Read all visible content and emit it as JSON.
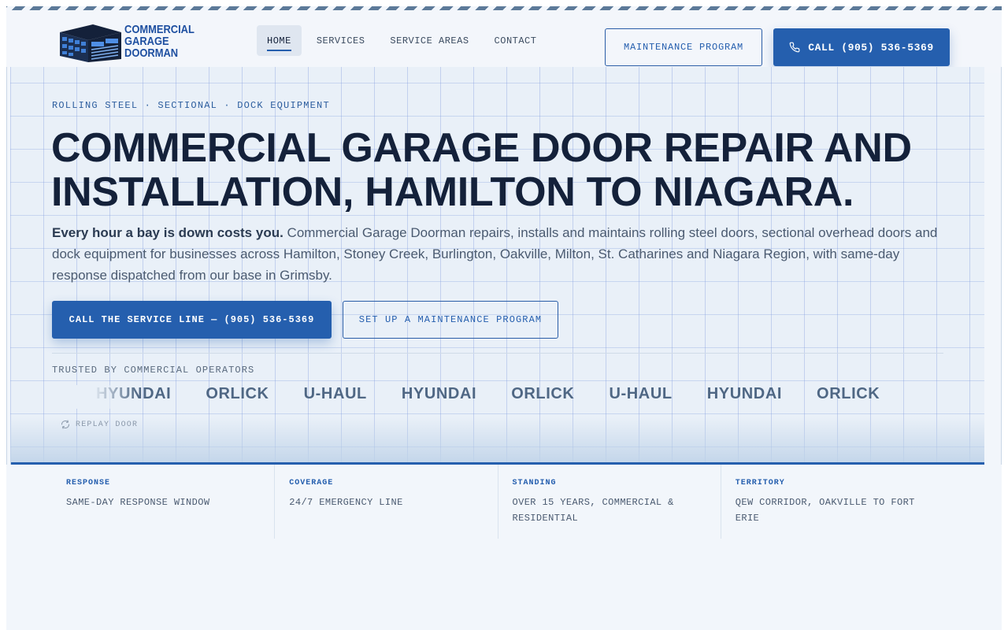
{
  "brand": {
    "logo_lines": [
      "COMMERCIAL",
      "GARAGE",
      "DOORMAN"
    ],
    "accent": "#255fae",
    "ink": "#14213a"
  },
  "nav": {
    "items": [
      {
        "label": "HOME",
        "active": true
      },
      {
        "label": "SERVICES",
        "active": false
      },
      {
        "label": "SERVICE AREAS",
        "active": false
      },
      {
        "label": "CONTACT",
        "active": false
      }
    ],
    "maintenance_button": "MAINTENANCE PROGRAM",
    "call_button": "CALL (905) 536-5369",
    "call_icon": "phone-icon"
  },
  "hero": {
    "eyebrow": "ROLLING STEEL · SECTIONAL · DOCK EQUIPMENT",
    "headline": "COMMERCIAL GARAGE DOOR REPAIR AND INSTALLATION, HAMILTON TO NIAGARA.",
    "lede_strong": "Every hour a bay is down costs you.",
    "lede_text": " Commercial Garage Doorman repairs, installs and maintains rolling steel doors, sectional overhead doors and dock equipment for businesses across Hamilton, Stoney Creek, Burlington, Oakville, Milton, St. Catharines and Niagara Region, with same-day response dispatched from our base in Grimsby.",
    "primary_cta": "CALL THE SERVICE LINE — (905) 536-5369",
    "secondary_cta": "SET UP A MAINTENANCE PROGRAM",
    "trusted_label": "TRUSTED BY COMMERCIAL OPERATORS",
    "trusted_brands": [
      "HYUNDAI",
      "ORLICK",
      "U-HAUL",
      "HYUNDAI",
      "ORLICK",
      "U-HAUL",
      "HYUNDAI",
      "ORLICK"
    ],
    "replay_label": "REPLAY DOOR",
    "replay_icon": "replay-icon"
  },
  "stats": [
    {
      "label": "RESPONSE",
      "value": "SAME-DAY RESPONSE WINDOW"
    },
    {
      "label": "COVERAGE",
      "value": "24/7 EMERGENCY LINE"
    },
    {
      "label": "STANDING",
      "value": "OVER 15 YEARS, COMMERCIAL & RESIDENTIAL"
    },
    {
      "label": "TERRITORY",
      "value": "QEW CORRIDOR, OAKVILLE TO FORT ERIE"
    }
  ]
}
